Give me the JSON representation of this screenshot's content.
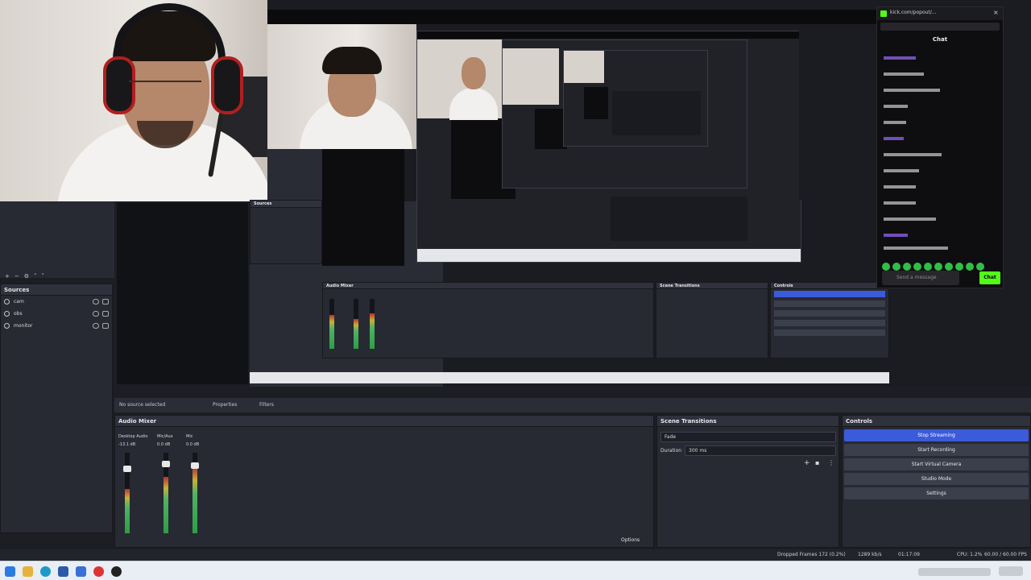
{
  "chat": {
    "address": "kick.com/popout/...",
    "title": "Chat",
    "messages": [
      {
        "user": "",
        "text": ""
      }
    ],
    "input_placeholder": "Send a message",
    "send_label": "Chat"
  },
  "scenes_nested": {
    "title": "Sources"
  },
  "sources": {
    "title": "Sources",
    "items": [
      {
        "name": "cam"
      },
      {
        "name": "obs"
      },
      {
        "name": "monitor"
      }
    ]
  },
  "properties_bar": {
    "no_source": "No source selected",
    "properties": "Properties",
    "filters": "Filters"
  },
  "audio_mixer": {
    "title": "Audio Mixer",
    "channels": [
      {
        "name": "Desktop Audio",
        "db": "-13.1 dB",
        "level": 0.55
      },
      {
        "name": "Mic/Aux",
        "db": "0.0 dB",
        "level": 0.7
      },
      {
        "name": "Mic",
        "db": "0.0 dB",
        "level": 0.82
      }
    ],
    "footer_label": "Options"
  },
  "transitions": {
    "title": "Scene Transitions",
    "transition": "Fade",
    "duration_label": "Duration",
    "duration_value": "300 ms"
  },
  "controls": {
    "title": "Controls",
    "buttons": [
      "Stop Streaming",
      "Start Recording",
      "Start Virtual Camera",
      "Studio Mode",
      "Settings"
    ]
  },
  "status_bar": {
    "dropped": "Dropped Frames 172 (0.2%)",
    "bitrate": "1289 kb/s",
    "time": "01:17:09",
    "cpu": "CPU: 1.2%",
    "fps": "60.00 / 60.00 FPS"
  },
  "colors": {
    "accent": "#3b5bdb",
    "kick_green": "#53fc18"
  }
}
